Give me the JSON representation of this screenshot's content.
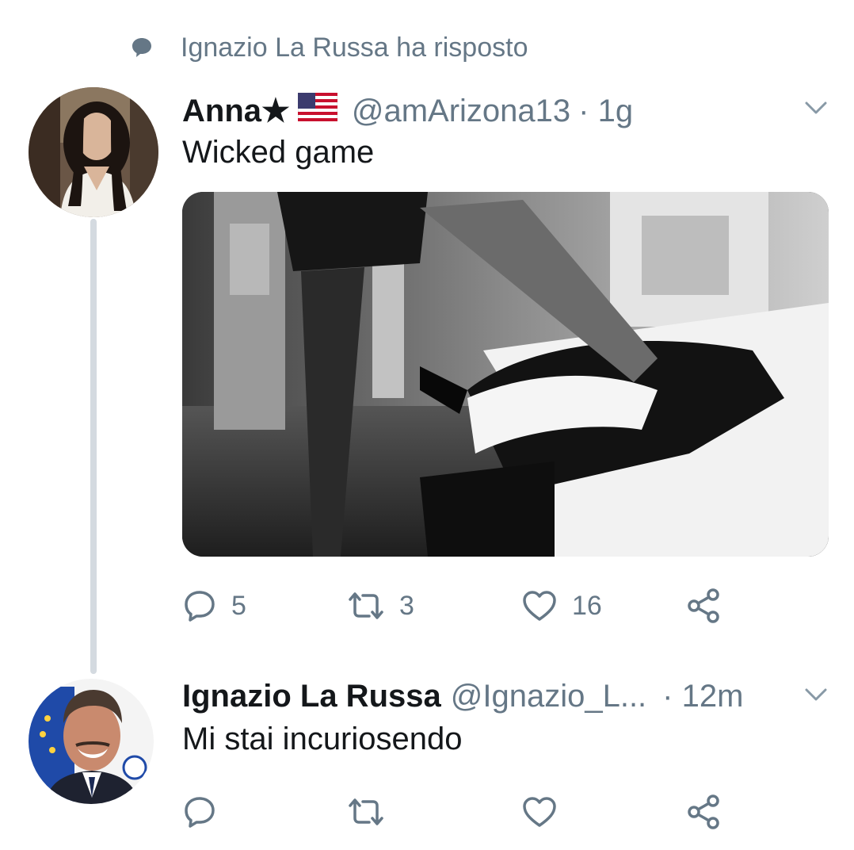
{
  "context": {
    "icon": "speech-bubble-icon",
    "text": "Ignazio La Russa ha risposto"
  },
  "tweets": [
    {
      "name": "Anna★",
      "flag_icon": "us-flag-icon",
      "handle": "@amArizona13",
      "time": "· 1g",
      "text": "Wicked game",
      "has_media": true,
      "media_description_icon": "photo",
      "actions": {
        "reply_count": "5",
        "retweet_count": "3",
        "like_count": "16"
      }
    },
    {
      "name": "Ignazio La Russa",
      "handle": "@Ignazio_L...",
      "time": "· 12m",
      "text": "Mi stai incuriosendo",
      "actions": {
        "reply_count": "",
        "retweet_count": "",
        "like_count": ""
      }
    }
  ],
  "colors": {
    "muted": "#657786",
    "text": "#14171a",
    "thread_line": "#d4dae0"
  }
}
